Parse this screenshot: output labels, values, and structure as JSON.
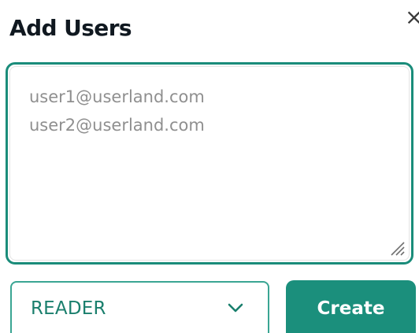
{
  "dialog": {
    "title": "Add Users",
    "close_label": "×"
  },
  "users_input": {
    "placeholder": "user1@userland.com\nuser2@userland.com",
    "value": ""
  },
  "role_select": {
    "selected": "READER"
  },
  "create_button": {
    "label": "Create"
  },
  "colors": {
    "accent": "#1b8f7c",
    "focus_border": "#1a8c7a",
    "title_text": "#101820",
    "placeholder_text": "#8f8f8f"
  },
  "icons": {
    "close": "close-icon",
    "dropdown": "chevron-down-icon",
    "resize": "resize-handle-icon"
  }
}
